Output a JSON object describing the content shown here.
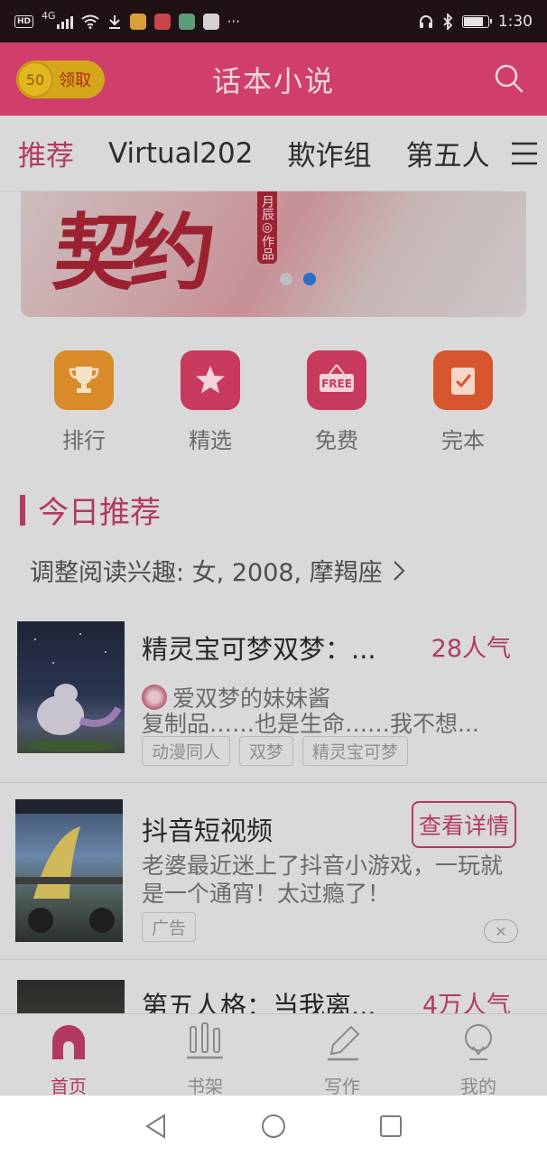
{
  "status_bar": {
    "network": "4G",
    "time": "1:30"
  },
  "header": {
    "coins": "50",
    "claim_label": "领取",
    "title": "话本小说"
  },
  "tabs": [
    "推荐",
    "Virtual202",
    "欺诈组",
    "第五人"
  ],
  "banner": {
    "title": "契约",
    "author_tag": "月辰◎作品"
  },
  "categories": [
    {
      "label": "排行",
      "icon": "trophy-icon",
      "color": "#d98a29"
    },
    {
      "label": "精选",
      "icon": "star-icon",
      "color": "#c8395e"
    },
    {
      "label": "免费",
      "icon": "free-sign-icon",
      "color": "#c8395e"
    },
    {
      "label": "完本",
      "icon": "checked-book-icon",
      "color": "#d7562e"
    }
  ],
  "section": {
    "title": "今日推荐",
    "interest": "调整阅读兴趣: 女, 2008, 摩羯座"
  },
  "items": [
    {
      "title": "精灵宝可梦双梦：...",
      "popularity": "28人气",
      "author": "爱双梦的妹妹酱",
      "desc": "复制品……也是生命……我不想...",
      "tags": [
        "动漫同人",
        "双梦",
        "精灵宝可梦"
      ]
    },
    {
      "title": "抖音短视频",
      "button": "查看详情",
      "desc": "老婆最近迷上了抖音小游戏，一玩就是一个通宵！太过瘾了！",
      "ad_tag": "广告"
    },
    {
      "title": "第五人格：当我离...",
      "popularity": "4万人气"
    }
  ],
  "bottom_nav": [
    {
      "label": "首页",
      "icon": "home-icon",
      "active": true
    },
    {
      "label": "书架",
      "icon": "bookshelf-icon",
      "active": false
    },
    {
      "label": "写作",
      "icon": "pencil-icon",
      "active": false
    },
    {
      "label": "我的",
      "icon": "profile-icon",
      "active": false
    }
  ],
  "colors": {
    "brand": "#cf3f6a",
    "accent_text": "#b23a60",
    "coin": "#d4a619"
  }
}
